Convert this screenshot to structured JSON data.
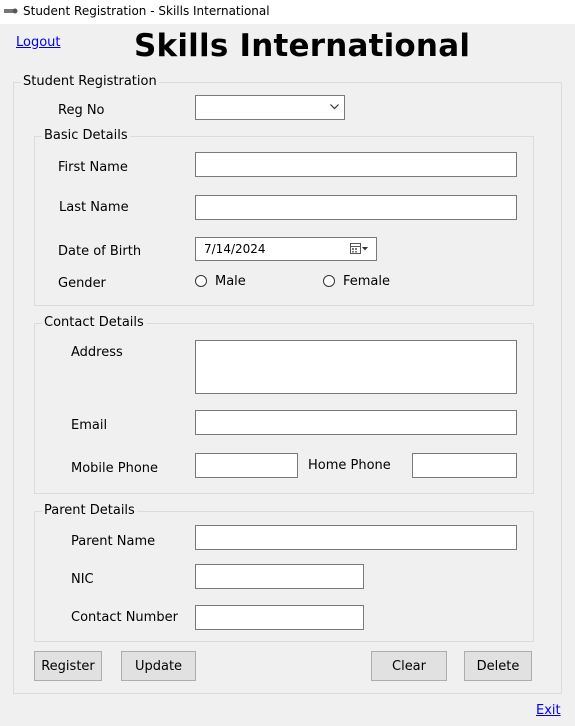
{
  "window": {
    "title": "Student Registration - Skills International"
  },
  "header": {
    "logout_label": "Logout",
    "app_name": "Skills International"
  },
  "registration": {
    "group_label": "Student Registration",
    "reg_no_label": "Reg No",
    "reg_no_value": ""
  },
  "basic": {
    "group_label": "Basic Details",
    "first_name_label": "First Name",
    "last_name_label": "Last Name",
    "dob_label": "Date of Birth",
    "dob_value": "7/14/2024",
    "gender_label": "Gender",
    "gender_options": [
      "Male",
      "Female"
    ]
  },
  "contact": {
    "group_label": "Contact Details",
    "address_label": "Address",
    "email_label": "Email",
    "mobile_label": "Mobile Phone",
    "home_label": "Home Phone"
  },
  "parent": {
    "group_label": "Parent Details",
    "name_label": "Parent Name",
    "nic_label": "NIC",
    "contact_label": "Contact Number"
  },
  "actions": {
    "register": "Register",
    "update": "Update",
    "clear": "Clear",
    "delete": "Delete"
  },
  "footer": {
    "exit_label": "Exit"
  }
}
